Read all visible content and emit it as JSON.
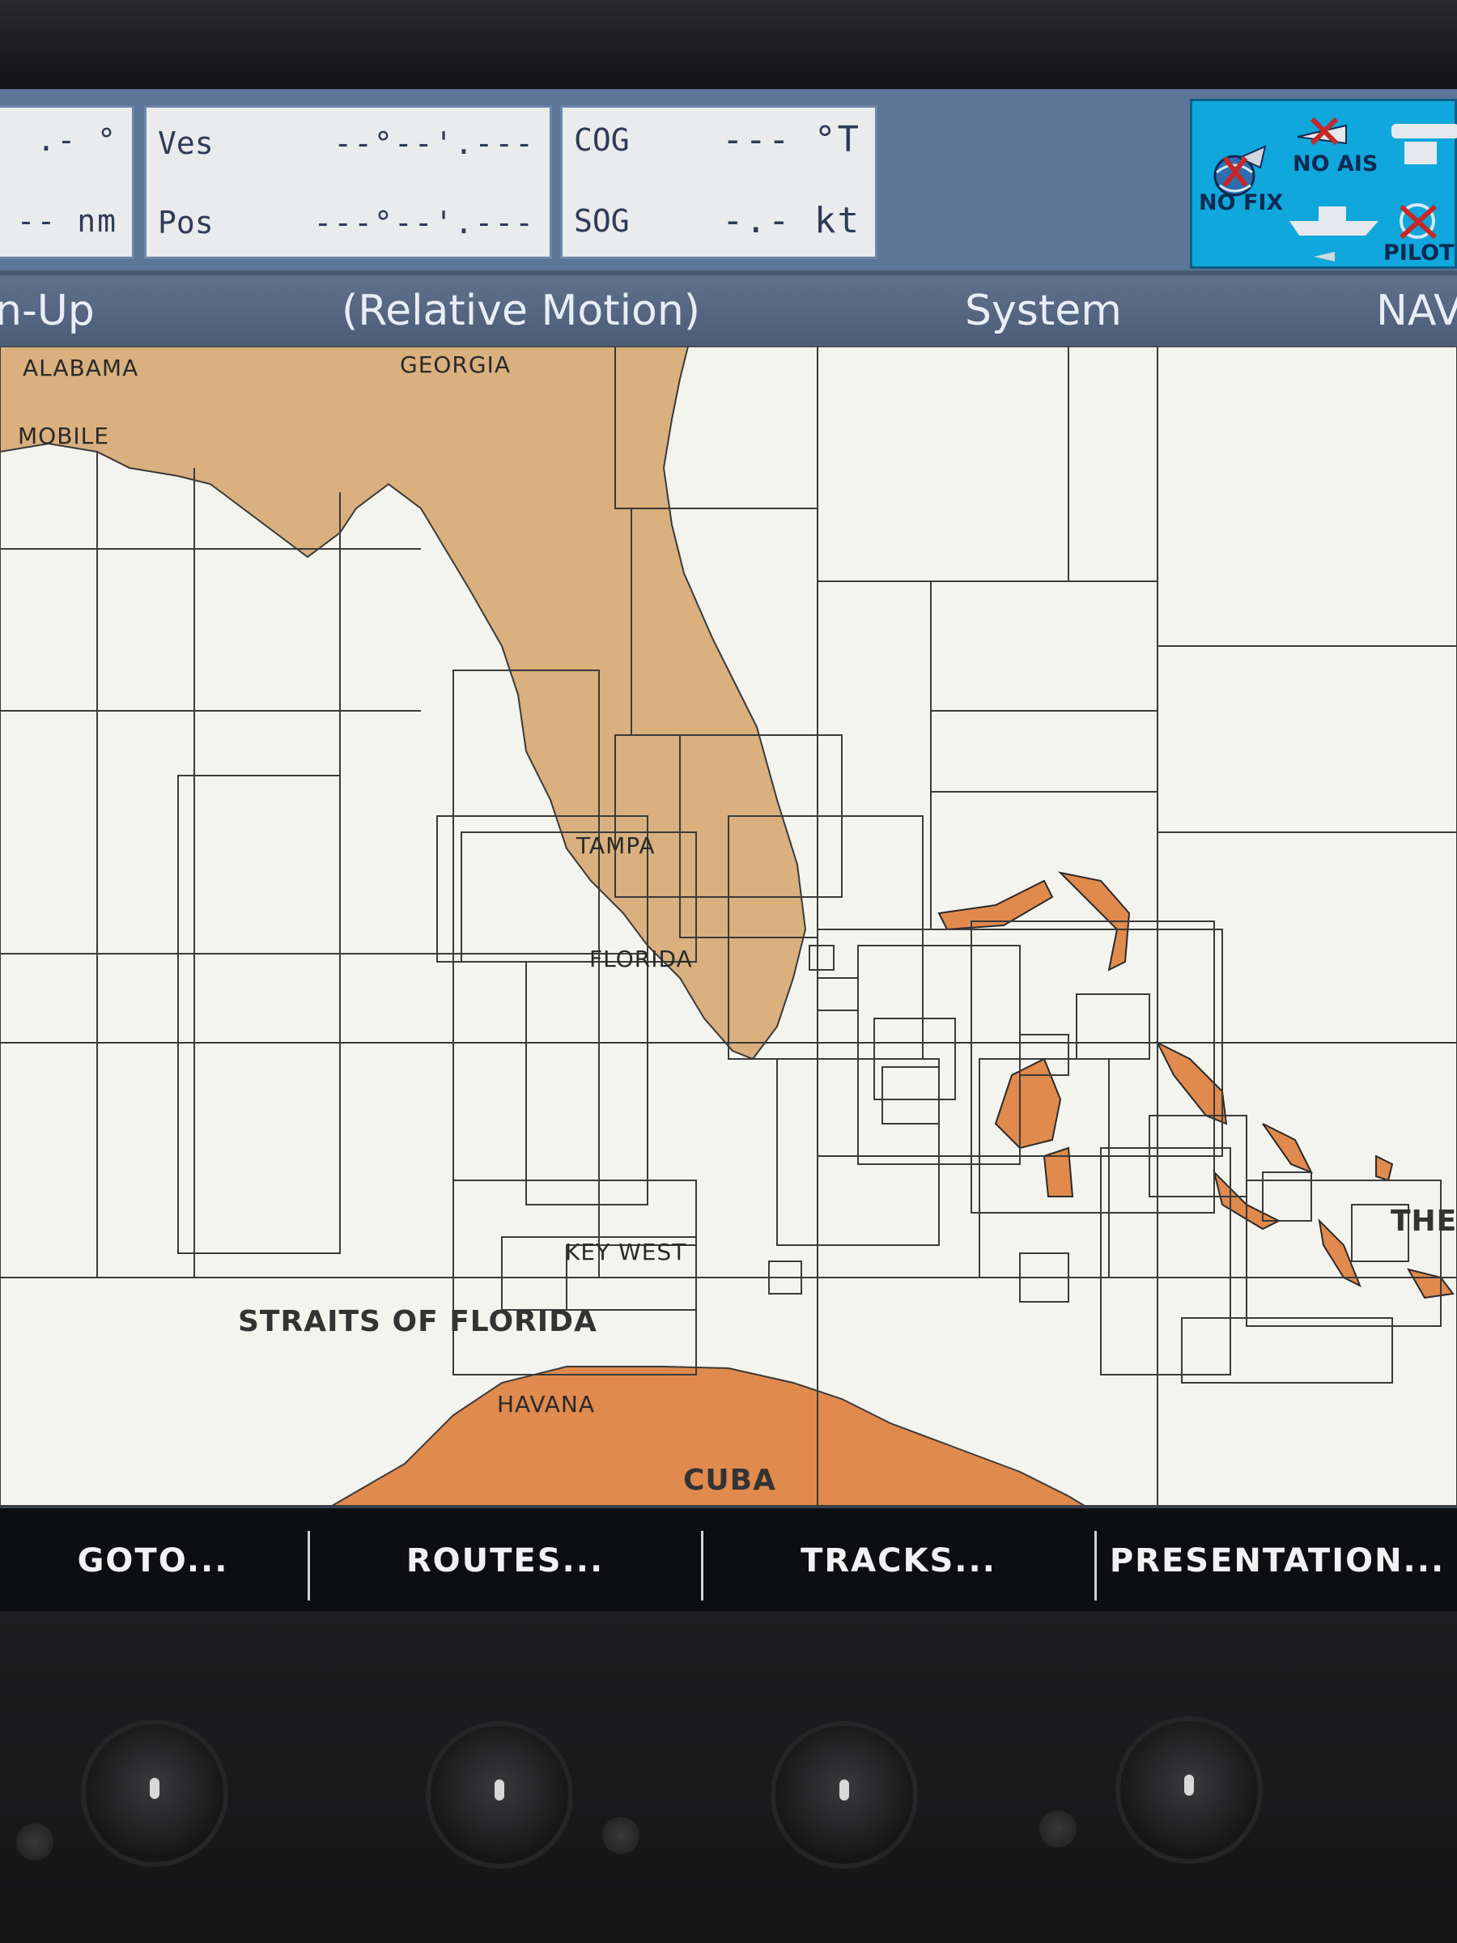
{
  "data_panel": {
    "partial_left": {
      "top_value": ".- °",
      "bottom_value": "-- nm"
    },
    "vessel": {
      "label": "Ves",
      "value": "--°--'.---"
    },
    "position": {
      "label": "Pos",
      "value": "---°--'.---"
    },
    "cog": {
      "label": "COG",
      "value": "--- °T"
    },
    "sog": {
      "label": "SOG",
      "value": "-.- kt"
    }
  },
  "status": {
    "no_fix": "NO FIX",
    "no_ais": "NO AIS",
    "pilot": "PILOT"
  },
  "header": {
    "orientation": "n-Up",
    "motion": "(Relative Motion)",
    "system": "System",
    "nav": "NAV"
  },
  "map_labels": {
    "alabama": "ALABAMA",
    "georgia": "GEORGIA",
    "mobile": "MOBILE",
    "tampa": "TAMPA",
    "florida": "FLORIDA",
    "key_west": "KEY WEST",
    "straits": "STRAITS OF FLORIDA",
    "havana": "HAVANA",
    "cuba": "CUBA",
    "the": "THE"
  },
  "softkeys": {
    "goto": "GOTO...",
    "routes": "ROUTES...",
    "tracks": "TRACKS...",
    "presentation": "PRESENTATION..."
  },
  "colors": {
    "florida_land": "#d9b07e",
    "cuba_land": "#e08a4e",
    "status_blue": "#0fa7dc",
    "chart_bg": "#f4f4ef"
  }
}
